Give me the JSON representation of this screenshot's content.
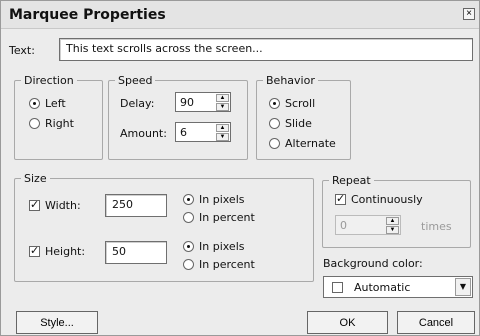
{
  "dialog": {
    "title": "Marquee Properties"
  },
  "text": {
    "label": "Text:",
    "value": "This text scrolls across the screen..."
  },
  "direction": {
    "legend": "Direction",
    "options": [
      "Left",
      "Right"
    ],
    "selected": "Left"
  },
  "speed": {
    "legend": "Speed",
    "delay_label": "Delay:",
    "delay_value": "90",
    "amount_label": "Amount:",
    "amount_value": "6"
  },
  "behavior": {
    "legend": "Behavior",
    "options": [
      "Scroll",
      "Slide",
      "Alternate"
    ],
    "selected": "Scroll"
  },
  "size": {
    "legend": "Size",
    "width_label": "Width:",
    "width_value": "250",
    "width_unit_options": [
      "In pixels",
      "In percent"
    ],
    "width_unit_selected": "In pixels",
    "height_label": "Height:",
    "height_value": "50",
    "height_unit_options": [
      "In pixels",
      "In percent"
    ],
    "height_unit_selected": "In pixels"
  },
  "repeat": {
    "legend": "Repeat",
    "continuously_label": "Continuously",
    "times_value": "0",
    "times_label": "times"
  },
  "background": {
    "label": "Background color:",
    "value": "Automatic"
  },
  "buttons": {
    "style": "Style...",
    "ok": "OK",
    "cancel": "Cancel"
  },
  "icons": {
    "close": "close-icon",
    "spin_up": "spin-up-icon",
    "spin_down": "spin-down-icon",
    "dropdown": "dropdown-arrow-icon"
  },
  "colors": {
    "dialog_bg": "#ececec",
    "border": "#a9a9a9"
  }
}
